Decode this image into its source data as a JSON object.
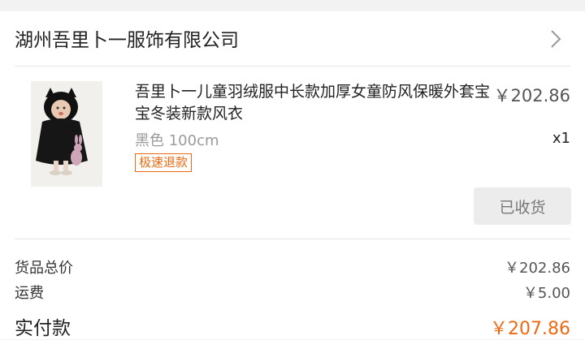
{
  "shop": {
    "name": "湖州吾里卜一服饰有限公司",
    "chevron_icon": "chevron-right-icon"
  },
  "product": {
    "image_icon": "product-photo-child-black-cape",
    "title": "吾里卜一儿童羽绒服中长款加厚女童防风保暖外套宝宝冬装新款风衣",
    "price": "￥202.86",
    "variant": "黑色 100cm",
    "quantity": "x1",
    "badge": "极速退款",
    "status_button": "已收货"
  },
  "summary": {
    "goods_total_label": "货品总价",
    "goods_total_value": "￥202.86",
    "shipping_label": "运费",
    "shipping_value": "￥5.00",
    "paid_label": "实付款",
    "paid_value": "￥207.86"
  },
  "colors": {
    "accent": "#ee6a12",
    "background": "#f2f2f2"
  }
}
